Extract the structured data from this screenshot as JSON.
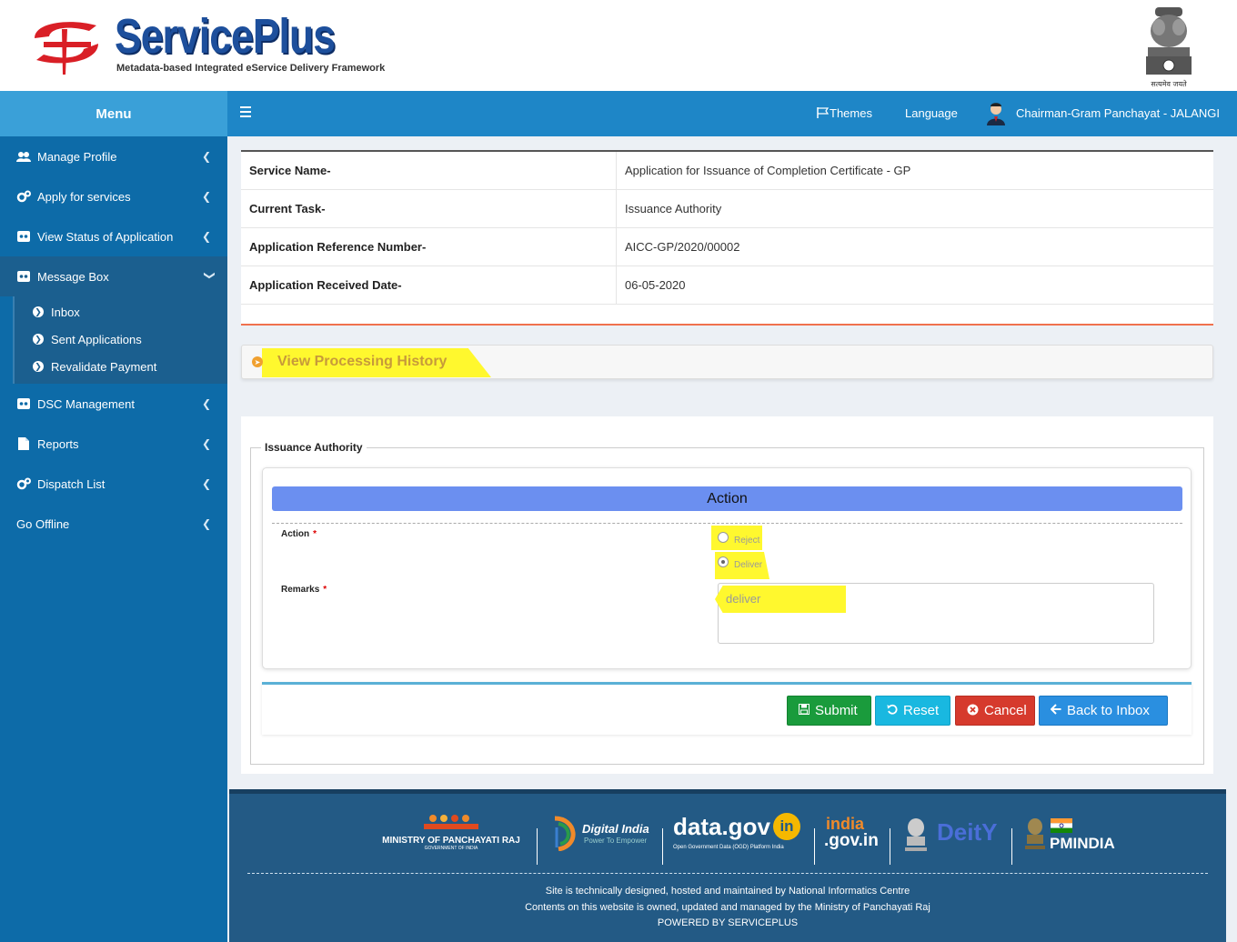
{
  "header": {
    "brand": "ServicePlus",
    "tagline": "Metadata-based Integrated eService Delivery Framework",
    "emblem_motto": "सत्यमेव जयते"
  },
  "sidebar": {
    "menu_title": "Menu",
    "items": [
      {
        "label": "Manage Profile",
        "icon": "users-icon"
      },
      {
        "label": "Apply for services",
        "icon": "gears-icon"
      },
      {
        "label": "View Status of Application",
        "icon": "status-icon"
      },
      {
        "label": "Message Box",
        "icon": "message-icon"
      },
      {
        "label": "DSC Management",
        "icon": "dsc-icon"
      },
      {
        "label": "Reports",
        "icon": "file-icon"
      },
      {
        "label": "Dispatch List",
        "icon": "gears-icon"
      },
      {
        "label": "Go Offline",
        "icon": ""
      }
    ],
    "submenu": [
      "Inbox",
      "Sent Applications",
      "Revalidate Payment"
    ]
  },
  "navbar": {
    "themes": "Themes",
    "language": "Language",
    "user": "Chairman-Gram Panchayat - JALANGI"
  },
  "application": {
    "rows": [
      {
        "key": "Service Name-",
        "value": "Application for Issuance of Completion Certificate - GP"
      },
      {
        "key": "Current Task-",
        "value": "Issuance Authority"
      },
      {
        "key": "Application Reference Number-",
        "value": "AICC-GP/2020/00002"
      },
      {
        "key": "Application Received Date-",
        "value": "06-05-2020"
      }
    ]
  },
  "history": {
    "label": "View Processing History"
  },
  "form": {
    "legend": "Issuance Authority",
    "action_header": "Action",
    "action_label": "Action",
    "remarks_label": "Remarks",
    "required_mark": "*",
    "options": [
      {
        "label": "Reject",
        "checked": false
      },
      {
        "label": "Deliver",
        "checked": true
      }
    ],
    "remarks_value": "deliver",
    "highlight_color": "#fff82e"
  },
  "buttons": {
    "submit": "Submit",
    "reset": "Reset",
    "cancel": "Cancel",
    "back": "Back to Inbox"
  },
  "footer": {
    "logos": {
      "panchayati": "MINISTRY OF PANCHAYATI RAJ",
      "panchayati_sub": "GOVERNMENT OF INDIA",
      "digital": "Digital India",
      "digital_sub": "Power To Empower",
      "datagov": "data.gov",
      "datagov_in": "in",
      "datagov_sub": "Open Government Data (OGD) Platform India",
      "india_gov_top": "india",
      "india_gov_bottom": ".gov.in",
      "deity": "DeitY",
      "pmindia": "PMINDIA"
    },
    "line1": "Site is technically designed, hosted and maintained by National Informatics Centre",
    "line2": "Contents on this website is owned, updated and managed by the Ministry of Panchayati Raj",
    "line3": "POWERED BY SERVICEPLUS"
  }
}
